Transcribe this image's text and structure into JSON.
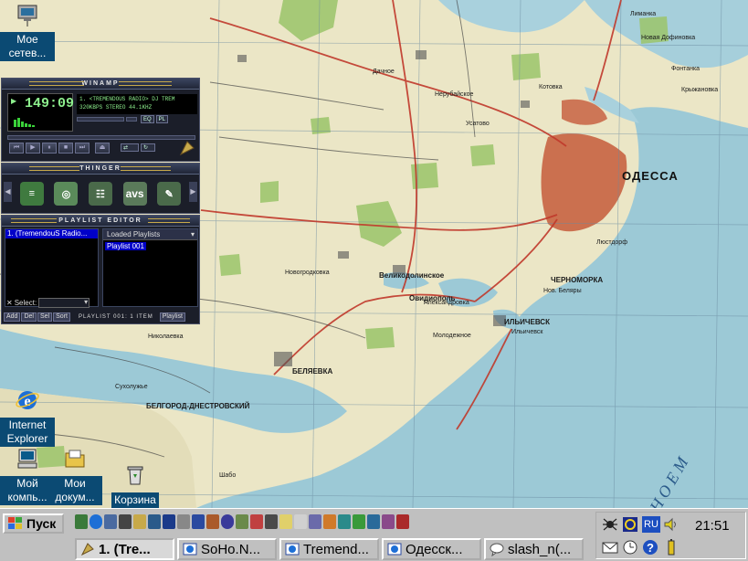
{
  "desktop": {
    "icons": [
      {
        "name": "my-network",
        "label": "Мое сетев...",
        "icon": "network-icon"
      },
      {
        "name": "internet-explorer",
        "label": "Internet Explorer",
        "icon": "ie-icon"
      },
      {
        "name": "my-computer",
        "label": "Мой компь...",
        "icon": "computer-icon"
      },
      {
        "name": "my-documents",
        "label": "Мои докум...",
        "icon": "documents-icon"
      },
      {
        "name": "recycle-bin",
        "label": "Корзина",
        "icon": "recycle-bin-icon"
      }
    ]
  },
  "map": {
    "city": "ОДЕССА",
    "labels": [
      "ИЛЬИЧЕВСК",
      "Ильичевск",
      "БЕЛГОРОД-ДНЕСТРОВСКИЙ",
      "БЕЛЯЕВКА",
      "ЧЕРНОМОРКА",
      "Овидиополь",
      "Николаевка",
      "Сухолужье",
      "Новогродковка",
      "Молодежное",
      "Великодолинское",
      "Александровка",
      "Дачное",
      "Котовка",
      "Усатово",
      "Нерубайское",
      "Фонтанка",
      "Крыжановка",
      "Лиманка",
      "Шабо",
      "Люстдорф",
      "Новая Дофиновка",
      "Нов. Беляры"
    ],
    "sea_label": "Н О Е М"
  },
  "winamp": {
    "main": {
      "title": "WINAMP",
      "time": "149:09",
      "track": "1.  <TREMENDOUS RADIO> DJ TREM",
      "kbps": "320KBPS",
      "mode": "STEREO",
      "khz": "44.1KHZ",
      "eq_label": "EQ",
      "pl_label": "PL"
    },
    "thinger": {
      "title": "THINGER",
      "avs_label": "avs"
    },
    "playlist": {
      "title": "PLAYLIST EDITOR",
      "items": [
        "1. (TremendouS Radio..."
      ],
      "loaded_label": "Loaded Playlists",
      "playlists": [
        "Playlist 001"
      ],
      "select_label": "Select:",
      "buttons": {
        "add": "Add",
        "del": "Del",
        "sel": "Sel",
        "sort": "Sort",
        "playlist": "Playlist"
      },
      "status": "PLAYLIST 001: 1 ITEM"
    }
  },
  "taskbar": {
    "start_label": "Пуск",
    "tasks": [
      {
        "label": "1. (Tre...",
        "active": true
      },
      {
        "label": "SoHo.N...",
        "active": false
      },
      {
        "label": "Tremend...",
        "active": false
      },
      {
        "label": "Одесск...",
        "active": false
      },
      {
        "label": "slash_n(...",
        "active": false
      }
    ],
    "tray": {
      "lang": "RU",
      "clock": "21:51"
    }
  }
}
